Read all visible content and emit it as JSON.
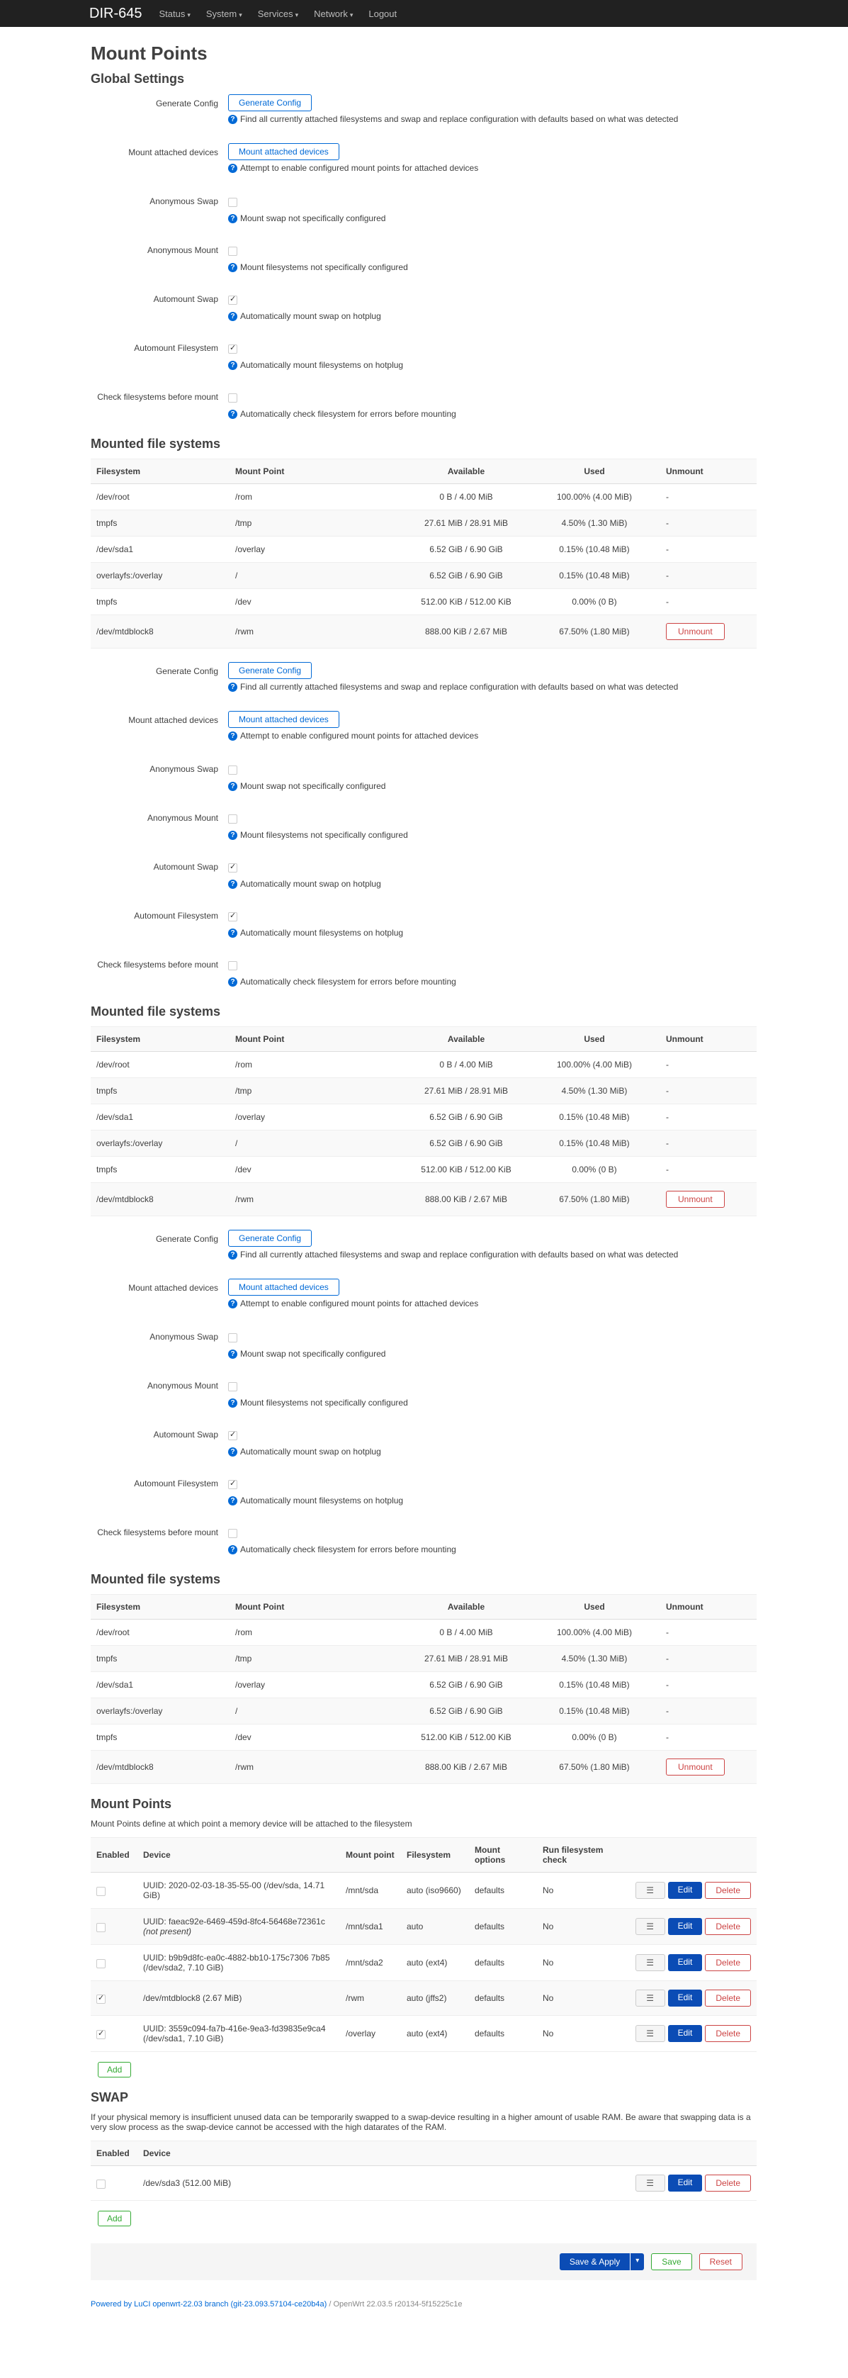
{
  "nav": {
    "brand": "DIR-645",
    "items": [
      "Status",
      "System",
      "Services",
      "Network",
      "Logout"
    ]
  },
  "page_title": "Mount Points",
  "global_title": "Global Settings",
  "settings": {
    "generate_config": {
      "label": "Generate Config",
      "button": "Generate Config",
      "hint": "Find all currently attached filesystems and swap and replace configuration with defaults based on what was detected"
    },
    "mount_attached": {
      "label": "Mount attached devices",
      "button": "Mount attached devices",
      "hint": "Attempt to enable configured mount points for attached devices"
    },
    "anon_swap": {
      "label": "Anonymous Swap",
      "hint": "Mount swap not specifically configured",
      "checked": false
    },
    "anon_mount": {
      "label": "Anonymous Mount",
      "hint": "Mount filesystems not specifically configured",
      "checked": false
    },
    "automount_swap": {
      "label": "Automount Swap",
      "hint": "Automatically mount swap on hotplug",
      "checked": true
    },
    "automount_fs": {
      "label": "Automount Filesystem",
      "hint": "Automatically mount filesystems on hotplug",
      "checked": true
    },
    "check_fs": {
      "label": "Check filesystems before mount",
      "hint": "Automatically check filesystem for errors before mounting",
      "checked": false
    }
  },
  "mounted": {
    "title": "Mounted file systems",
    "headers": [
      "Filesystem",
      "Mount Point",
      "Available",
      "Used",
      "Unmount"
    ],
    "rows": [
      [
        "/dev/root",
        "/rom",
        "0 B / 4.00 MiB",
        "100.00% (4.00 MiB)",
        "-"
      ],
      [
        "tmpfs",
        "/tmp",
        "27.61 MiB / 28.91 MiB",
        "4.50% (1.30 MiB)",
        "-"
      ],
      [
        "/dev/sda1",
        "/overlay",
        "6.52 GiB / 6.90 GiB",
        "0.15% (10.48 MiB)",
        "-"
      ],
      [
        "overlayfs:/overlay",
        "/",
        "6.52 GiB / 6.90 GiB",
        "0.15% (10.48 MiB)",
        "-"
      ],
      [
        "tmpfs",
        "/dev",
        "512.00 KiB / 512.00 KiB",
        "0.00% (0 B)",
        "-"
      ],
      [
        "/dev/mtdblock8",
        "/rwm",
        "888.00 KiB / 2.67 MiB",
        "67.50% (1.80 MiB)",
        "Unmount"
      ]
    ]
  },
  "mount_points": {
    "title": "Mount Points",
    "desc": "Mount Points define at which point a memory device will be attached to the filesystem",
    "headers": [
      "Enabled",
      "Device",
      "Mount point",
      "Filesystem",
      "Mount options",
      "Run filesystem check"
    ],
    "rows": [
      {
        "enabled": false,
        "device": "UUID: 2020-02-03-18-35-55-00 (/dev/sda, 14.71 GiB)",
        "mount": "/mnt/sda",
        "fs": "auto (iso9660)",
        "opts": "defaults",
        "check": "No"
      },
      {
        "enabled": false,
        "device": "UUID: faeac92e-6469-459d-8fc4-56468e72361c",
        "device2": "(not present)",
        "mount": "/mnt/sda1",
        "fs": "auto",
        "opts": "defaults",
        "check": "No"
      },
      {
        "enabled": false,
        "device": "UUID: b9b9d8fc-ea0c-4882-bb10-175c7306 7b85 (/dev/sda2, 7.10 GiB)",
        "mount": "/mnt/sda2",
        "fs": "auto (ext4)",
        "opts": "defaults",
        "check": "No"
      },
      {
        "enabled": true,
        "device": "/dev/mtdblock8 (2.67 MiB)",
        "mount": "/rwm",
        "fs": "auto (jffs2)",
        "opts": "defaults",
        "check": "No"
      },
      {
        "enabled": true,
        "device": "UUID: 3559c094-fa7b-416e-9ea3-fd39835e9ca4 (/dev/sda1, 7.10 GiB)",
        "mount": "/overlay",
        "fs": "auto (ext4)",
        "opts": "defaults",
        "check": "No"
      }
    ],
    "edit": "Edit",
    "delete": "Delete",
    "menu": "☰",
    "add": "Add"
  },
  "swap": {
    "title": "SWAP",
    "desc": "If your physical memory is insufficient unused data can be temporarily swapped to a swap-device resulting in a higher amount of usable RAM. Be aware that swapping data is a very slow process as the swap-device cannot be accessed with the high datarates of the RAM.",
    "headers": [
      "Enabled",
      "Device"
    ],
    "rows": [
      {
        "enabled": false,
        "device": "/dev/sda3 (512.00 MiB)"
      }
    ],
    "add": "Add"
  },
  "actions": {
    "save_apply": "Save & Apply",
    "save": "Save",
    "reset": "Reset"
  },
  "footer": {
    "link": "Powered by LuCI openwrt-22.03 branch (git-23.093.57104-ce20b4a)",
    "sep": " / ",
    "version": "OpenWrt 22.03.5 r20134-5f15225c1e"
  }
}
